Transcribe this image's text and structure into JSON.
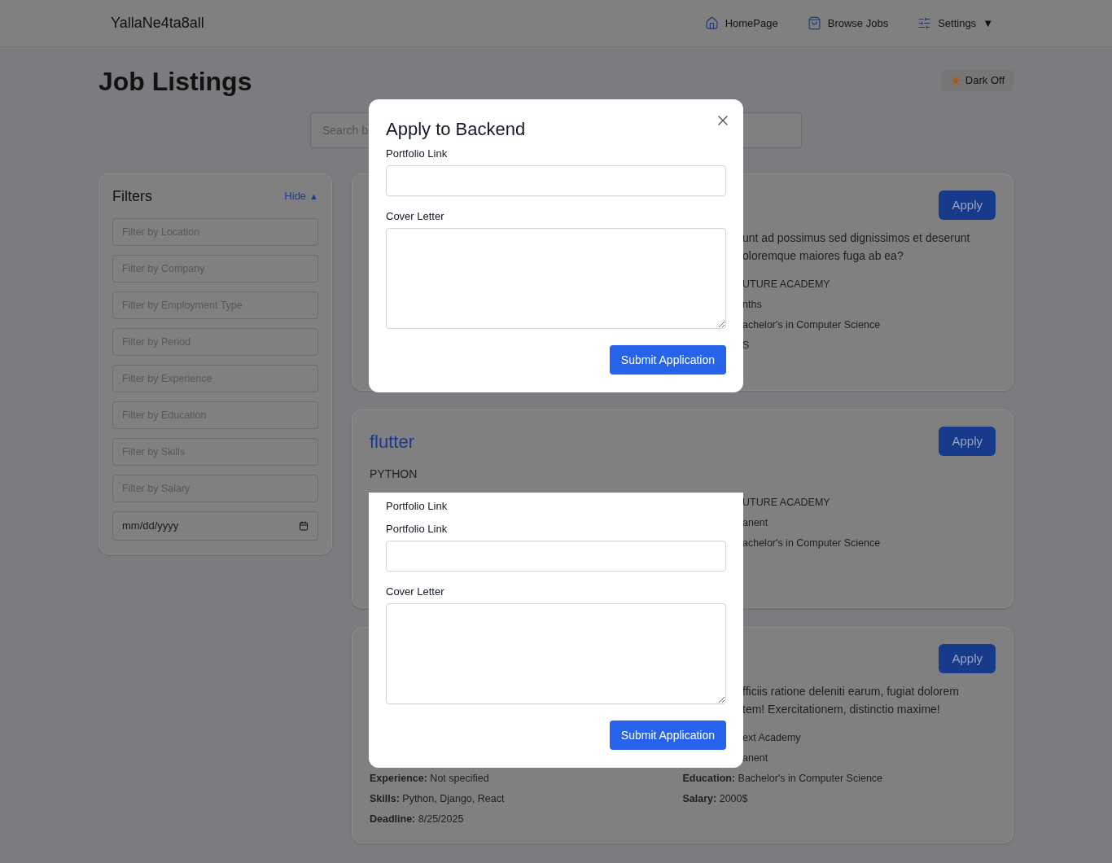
{
  "header": {
    "brand": "YallaNe4ta8all",
    "nav": [
      {
        "label": "HomePage"
      },
      {
        "label": "Browse Jobs"
      },
      {
        "label": "Settings",
        "caret": "▼"
      }
    ]
  },
  "page_title": "Job Listings",
  "theme_toggle": {
    "label": "Dark Off"
  },
  "search": {
    "placeholder": "Search b"
  },
  "filters": {
    "title": "Filters",
    "toggle": "Hide",
    "toggle_caret": "▲",
    "fields": [
      {
        "placeholder": "Filter by Location"
      },
      {
        "placeholder": "Filter by Company"
      },
      {
        "placeholder": "Filter by Employment Type"
      },
      {
        "placeholder": "Filter by Period"
      },
      {
        "placeholder": "Filter by Experience"
      },
      {
        "placeholder": "Filter by Education"
      },
      {
        "placeholder": "Filter by Skills"
      },
      {
        "placeholder": "Filter by Salary"
      }
    ],
    "date_field": {
      "placeholder": "mm/dd/yyyy"
    }
  },
  "jobs": [
    {
      "apply": "Apply",
      "description": [
        "unt ad possimus sed dignissimos et deserunt",
        "oloremque maiores fuga ab ea?"
      ],
      "details": [
        {
          "kind": "fragment",
          "text": "UTURE ACADEMY"
        },
        {
          "kind": "fragment",
          "text": "nths"
        },
        {
          "kind": "fragment",
          "text": "achelor's in Computer Science"
        },
        {
          "kind": "fragment",
          "text": "S"
        }
      ]
    },
    {
      "title": "flutter",
      "company": "PYTHON",
      "apply": "Apply",
      "details": [
        {
          "kind": "fragment",
          "text": "UTURE ACADEMY"
        },
        {
          "kind": "fragment",
          "text": "anent"
        },
        {
          "kind": "fragment",
          "text": "achelor's in Computer Science"
        }
      ]
    },
    {
      "apply": "Apply",
      "description": [
        "fficiis ratione deleniti earum, fugiat dolorem",
        "tem! Exercitationem, distinctio maxime!"
      ],
      "details": [
        {
          "kind": "fragment",
          "text": "ext Academy"
        },
        {
          "kind": "fragment",
          "text": "anent"
        }
      ],
      "fields": [
        [
          {
            "label": "Experience:",
            "value": "Not specified"
          },
          {
            "label": "Education:",
            "value": "Bachelor's in Computer Science"
          }
        ],
        [
          {
            "label": "Skills:",
            "value": "Python, Django, React"
          },
          {
            "label": "Salary:",
            "value": "2000$"
          }
        ],
        [
          {
            "label": "Deadline:",
            "value": "8/25/2025"
          }
        ]
      ]
    }
  ],
  "modals": [
    {
      "title": "Apply to Backend",
      "portfolio_label": "Portfolio Link",
      "cover_label": "Cover Letter",
      "submit": "Submit Application"
    },
    {
      "top_label": "Portfolio Link",
      "portfolio_label": "Portfolio Link",
      "cover_label": "Cover Letter",
      "submit": "Submit Application"
    }
  ]
}
